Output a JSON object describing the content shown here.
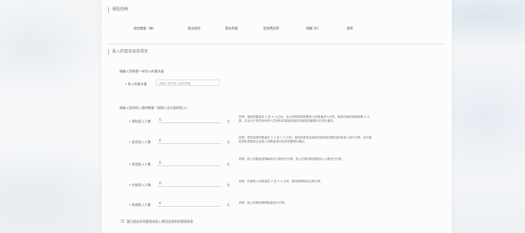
{
  "header": {
    "title": "保险险种"
  },
  "tabs": [
    "保险数量（每）",
    "营业保险",
    "营本免税",
    "医保费用率",
    "保额飞行",
    "税率"
  ],
  "section2": {
    "title": "投入的基本信息规定"
  },
  "area1": {
    "hint": "请输入您希望一年投入的基本量",
    "label": "• 投入的基本量",
    "placeholder": "请输入您的投入量的数值"
  },
  "area2": {
    "hint": "请输入您的投入量的数量（按照人员分配的投入）"
  },
  "rows": [
    {
      "label": "• 保险投入人数",
      "value": "0",
      "unit": "名",
      "desc": "说明：保险的数量在 0 至 0 人之间，会计的费用将按照投入的数值进行计算，相关的保险费用按照 0 计算，并且对于您的所有的人员资料将保留到相关的保险的管理中并进行保存。"
    },
    {
      "label": "• 投资投入人数",
      "value": "0",
      "unit": "名",
      "desc": "说明：您的投资的数量在 0 人至 0 人之间，相关的费用及保险的投资将按照当前的投入进行计算，并对保险的投资费用以及投入的数量进行相关的管理与确认。"
    },
    {
      "label": "• 其他投入人数",
      "value": "0",
      "unit": "名",
      "desc": "说明：投入的数量按照每年的人数进行计算，投入的费用将按照投入人数进行分配。"
    },
    {
      "label": "• 外部投入人数",
      "value": "0",
      "unit": "名",
      "desc": "说明：外部投入的数量在 0 至 0 人之间，费用按照相应比例计算。"
    },
    {
      "label": "• 其他投入人数",
      "value": "0",
      "unit": "名",
      "desc": "说明：投入的费用按照数量进行计算。"
    }
  ],
  "footer": {
    "check_label": "我已阅读并同意相关投入费用及保险的管理条款"
  }
}
